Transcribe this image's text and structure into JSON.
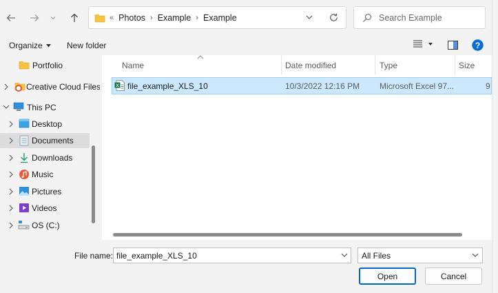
{
  "nav": {
    "back_icon": "back-arrow-icon",
    "forward_icon": "forward-arrow-icon",
    "up_icon": "up-arrow-icon"
  },
  "address": {
    "lead": "«",
    "crumbs": [
      "Photos",
      "Example",
      "Example"
    ]
  },
  "search": {
    "placeholder": "Search Example"
  },
  "toolbar": {
    "organize": "Organize",
    "new_folder": "New folder"
  },
  "sidebar": {
    "items": [
      {
        "label": "Portfolio",
        "icon": "folder-icon"
      },
      {
        "label": "Creative Cloud Files",
        "icon": "creative-cloud-icon"
      },
      {
        "label": "This PC",
        "icon": "pc-icon"
      },
      {
        "label": "Desktop",
        "icon": "desktop-icon"
      },
      {
        "label": "Documents",
        "icon": "documents-icon"
      },
      {
        "label": "Downloads",
        "icon": "downloads-icon"
      },
      {
        "label": "Music",
        "icon": "music-icon"
      },
      {
        "label": "Pictures",
        "icon": "pictures-icon"
      },
      {
        "label": "Videos",
        "icon": "videos-icon"
      },
      {
        "label": "OS (C:)",
        "icon": "drive-icon"
      }
    ]
  },
  "columns": {
    "name": "Name",
    "date": "Date modified",
    "type": "Type",
    "size": "Size"
  },
  "files": [
    {
      "name": "file_example_XLS_10",
      "date": "10/3/2022 12:16 PM",
      "type": "Microsoft Excel 97...",
      "size": "9"
    }
  ],
  "footer": {
    "file_name_label": "File name:",
    "file_name_value": "file_example_XLS_10",
    "file_type": "All Files",
    "open": "Open",
    "cancel": "Cancel"
  },
  "colors": {
    "selection": "#cce8ff",
    "accent": "#0067c0",
    "help": "#0a6ed1"
  }
}
